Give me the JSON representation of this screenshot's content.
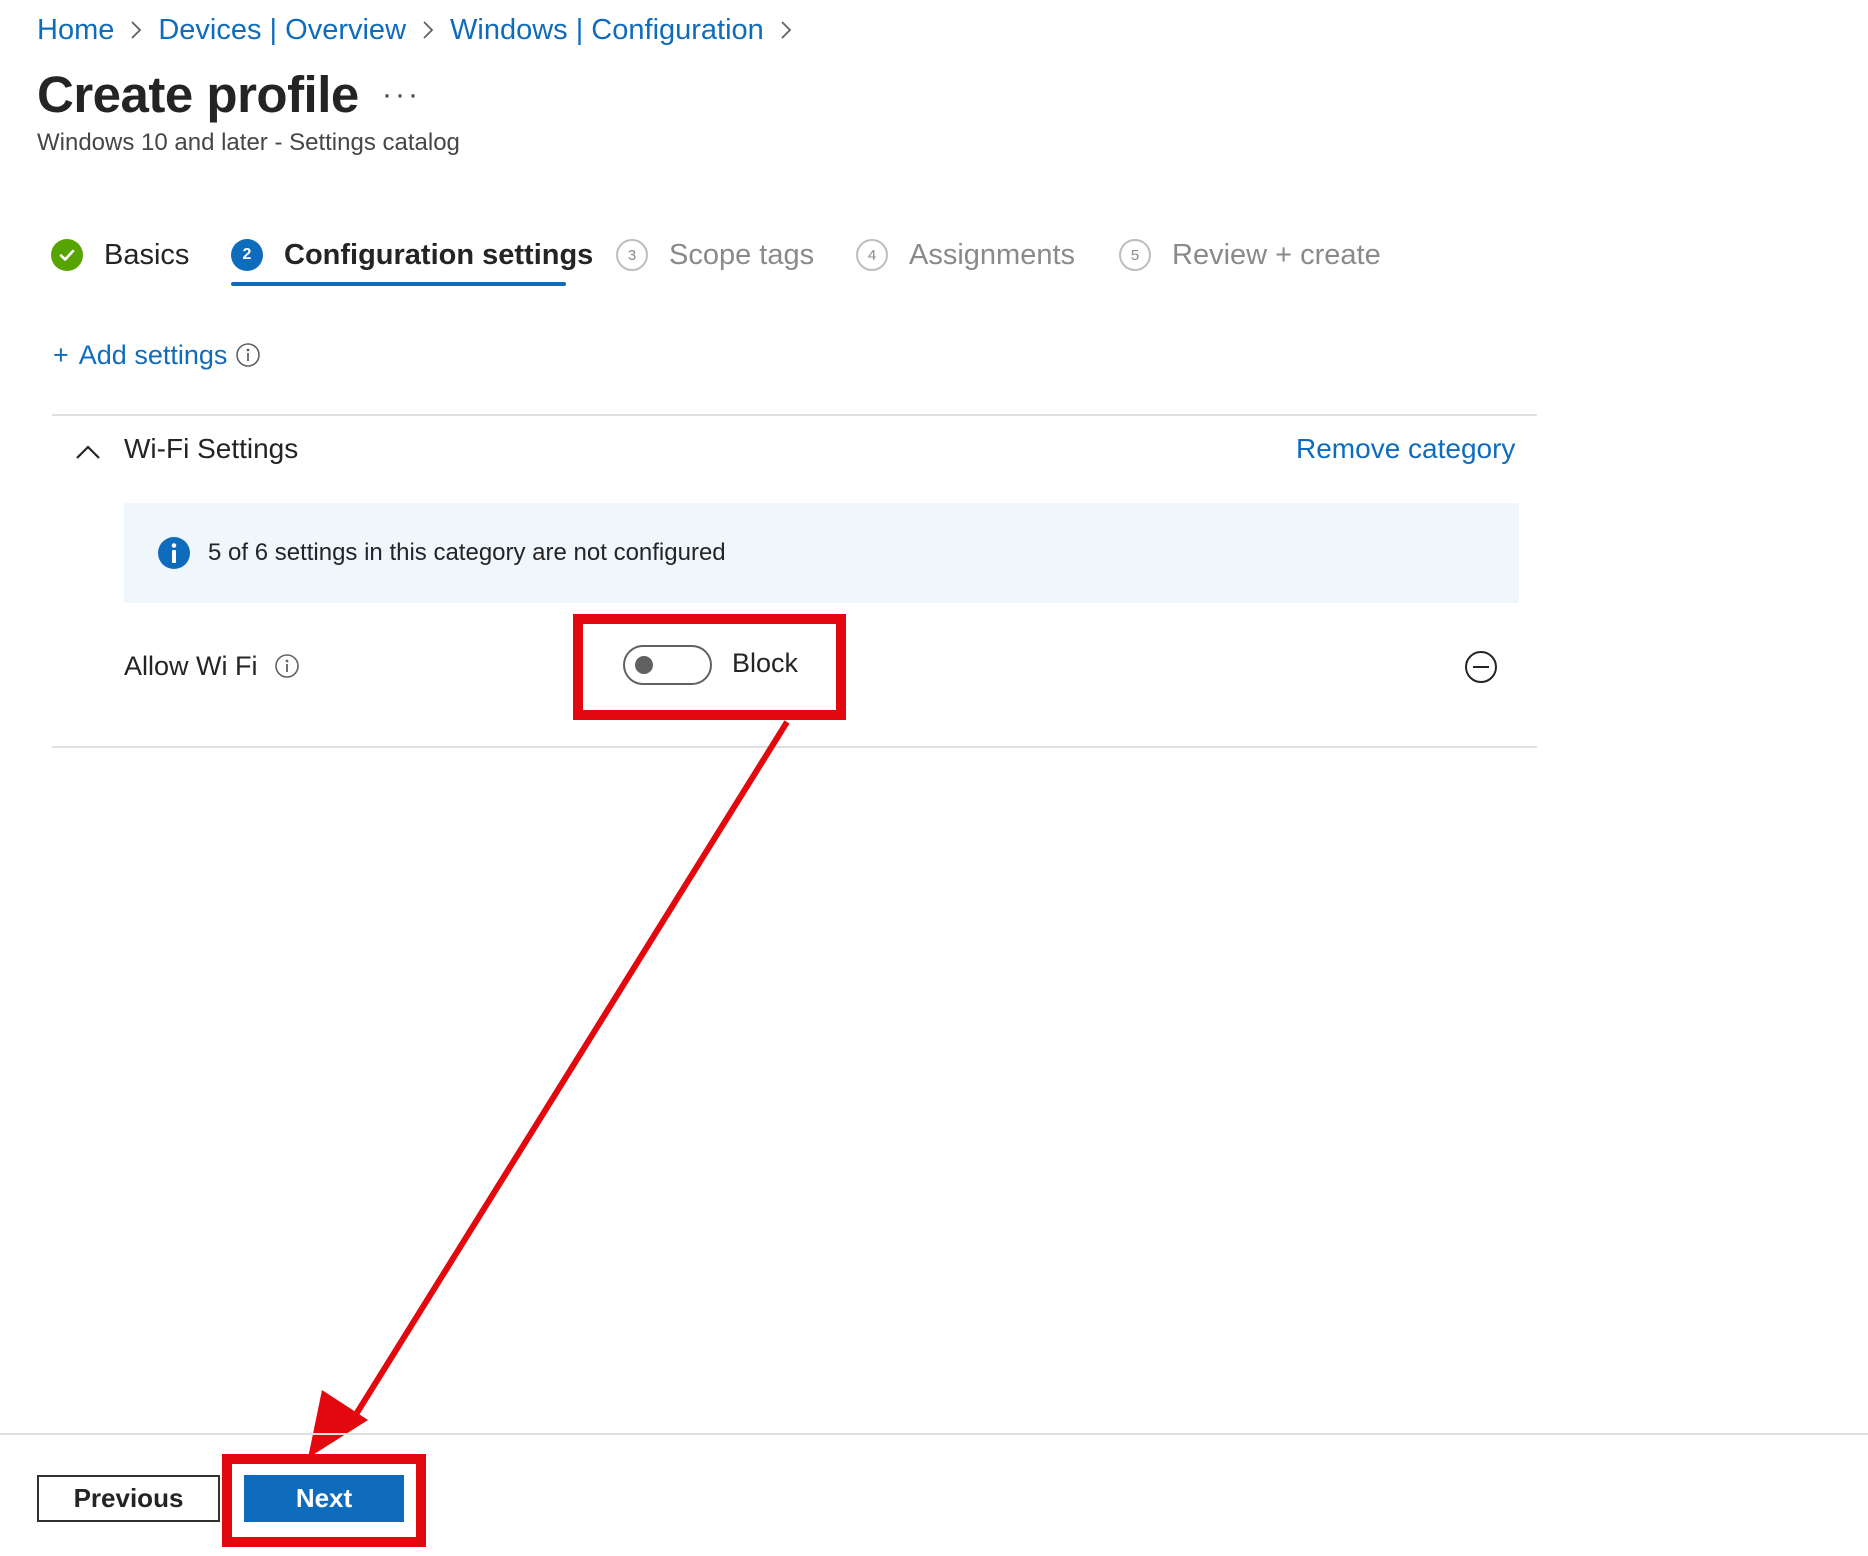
{
  "breadcrumb": [
    {
      "label": "Home"
    },
    {
      "label": "Devices | Overview"
    },
    {
      "label": "Windows | Configuration"
    }
  ],
  "header": {
    "title": "Create profile",
    "more_label": "···",
    "subtitle": "Windows 10 and later - Settings catalog"
  },
  "stepper": {
    "steps": [
      {
        "label": "Basics",
        "number": "",
        "state": "complete"
      },
      {
        "label": "Configuration settings",
        "number": "2",
        "state": "active"
      },
      {
        "label": "Scope tags",
        "number": "3",
        "state": "pending"
      },
      {
        "label": "Assignments",
        "number": "4",
        "state": "pending"
      },
      {
        "label": "Review + create",
        "number": "5",
        "state": "pending"
      }
    ]
  },
  "add_settings": {
    "plus": "+",
    "label": "Add settings"
  },
  "category": {
    "title": "Wi-Fi Settings",
    "remove_label": "Remove category",
    "banner_text": "5 of 6 settings in this category are not configured",
    "setting": {
      "label": "Allow Wi Fi",
      "toggle_state": "off",
      "toggle_label": "Block"
    }
  },
  "footer": {
    "previous_label": "Previous",
    "next_label": "Next"
  },
  "colors": {
    "link": "#0f6cbd",
    "primary_button": "#0f6cbd",
    "complete_step": "#57a300",
    "annotation": "#e3070e",
    "banner_bg": "#eff6fc"
  },
  "icons": [
    "chevron-right-icon",
    "checkmark-icon",
    "info-icon",
    "chevron-up-icon",
    "remove-circle-icon"
  ]
}
